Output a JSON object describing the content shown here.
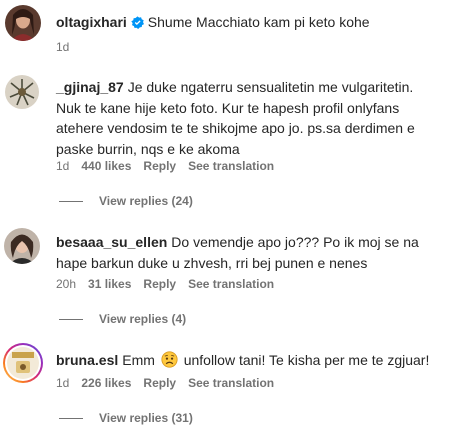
{
  "caption": {
    "username": "oltagixhari",
    "verified": true,
    "text": "Shume Macchiato kam pi keto kohe",
    "time": "1d",
    "avatar_icon": "profile-photo-woman"
  },
  "comments": [
    {
      "username": "_gjinaj_87",
      "text": "Je duke ngaterru sensualitetin me vulgaritetin. Nuk te kane hije keto foto. Kur te hapesh profil onlyfans atehere vendosim te te shikojme apo jo. ps.sa derdimen e paske burrin, nqs e ke akoma",
      "time": "1d",
      "likes": "440 likes",
      "reply_label": "Reply",
      "translation_label": "See translation",
      "view_replies": "View replies (24)",
      "avatar_icon": "profile-photo-plant"
    },
    {
      "username": "besaaa_su_ellen",
      "text": "Do vemendje apo jo??? Po ik moj se na hape barkun duke u zhvesh, rri bej punen e nenes",
      "time": "20h",
      "likes": "31 likes",
      "reply_label": "Reply",
      "translation_label": "See translation",
      "view_replies": "View replies (4)",
      "avatar_icon": "profile-photo-woman"
    },
    {
      "username": "bruna.esl",
      "text_before": "Emm",
      "emoji": "sad-face-emoji",
      "text_after": "unfollow tani! Te kisha per me te zgjuar!",
      "time": "1d",
      "likes": "226 likes",
      "reply_label": "Reply",
      "translation_label": "See translation",
      "view_replies": "View replies (31)",
      "avatar_icon": "profile-photo-story-ring"
    }
  ],
  "colors": {
    "text": "#262626",
    "secondary": "#737373",
    "verified": "#0095f6"
  }
}
